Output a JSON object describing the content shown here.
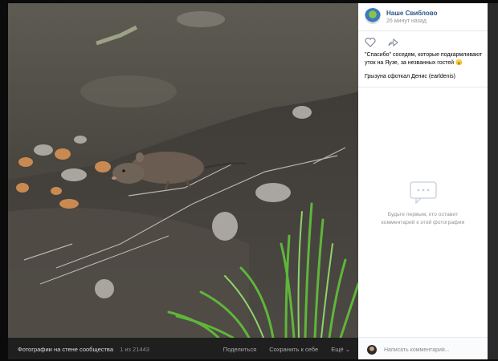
{
  "post": {
    "author": "Наше Свиблово",
    "time": "26 минут назад",
    "text": "\"Спасибо\" соседям, которые подкармливают уток на Яузе, за незванных гостей 😠",
    "credit": "Грызуна сфоткал Денис (earldenis)"
  },
  "comments": {
    "empty_message_line1": "Будьте первым, кто оставит",
    "empty_message_line2": "комментарий к этой фотографии",
    "input_placeholder": "Написать комментарий..."
  },
  "bottom_bar": {
    "album_title": "Фотографии на стене сообщества",
    "counter": "1 из 21443",
    "share": "Поделиться",
    "save": "Сохранить к себе",
    "more": "Ещё ⌄"
  },
  "colors": {
    "link": "#2a5885",
    "muted": "#939393",
    "overlay": "#1c1c1c"
  },
  "icons": {
    "like": "heart-icon",
    "share": "share-arrow-icon",
    "comments": "speech-bubble-icon"
  }
}
